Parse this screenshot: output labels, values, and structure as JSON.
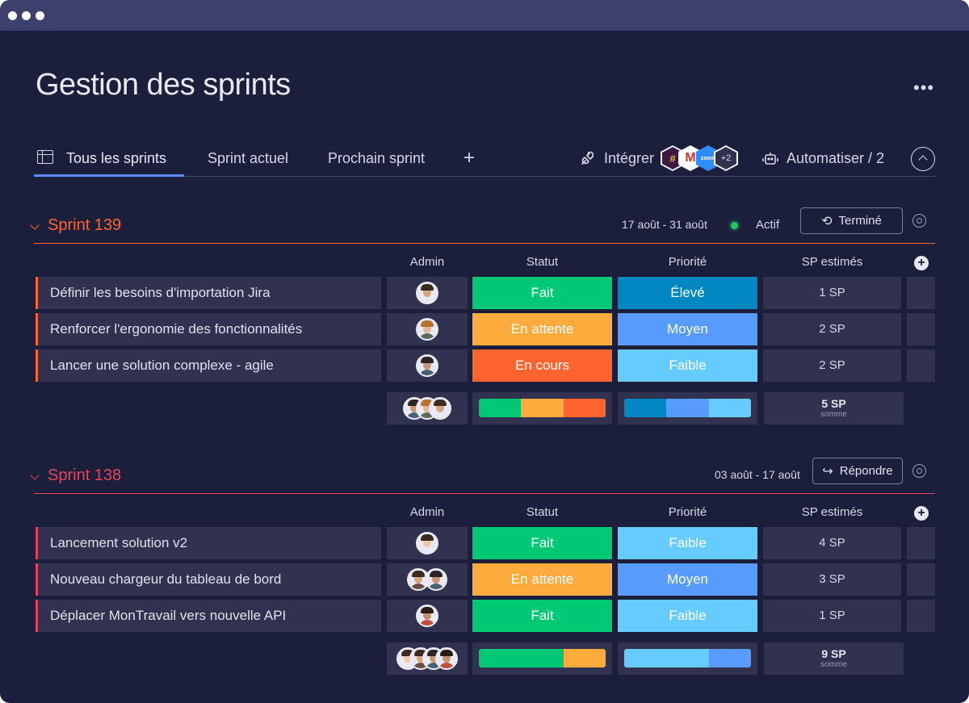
{
  "page": {
    "title": "Gestion des sprints"
  },
  "tabs": [
    {
      "label": "Tous les sprints",
      "active": true
    },
    {
      "label": "Sprint actuel"
    },
    {
      "label": "Prochain sprint"
    }
  ],
  "toolbar": {
    "integrate_label": "Intégrer",
    "integrations_more": "+2",
    "automate_label": "Automatiser / 2"
  },
  "columns": {
    "admin": "Admin",
    "status": "Statut",
    "priority": "Priorité",
    "sp": "SP estimés"
  },
  "colors": {
    "done": "#00c875",
    "waiting": "#fdab3d",
    "in_progress": "#ff642e",
    "high": "#0086c0",
    "medium": "#579bfc",
    "low": "#66ccff"
  },
  "groups": [
    {
      "title": "Sprint 139",
      "color": "#ff642e",
      "dates": "17 août - 31 août",
      "state": "Actif",
      "action": "Terminé",
      "rows": [
        {
          "name": "Définir les besoins d'importation Jira",
          "status": "Fait",
          "priority": "Élevé",
          "sp": "1 SP"
        },
        {
          "name": "Renforcer l'ergonomie des fonctionnalités",
          "status": "En attente",
          "priority": "Moyen",
          "sp": "2 SP"
        },
        {
          "name": "Lancer une solution complexe - agile",
          "status": "En cours",
          "priority": "Faible",
          "sp": "2 SP"
        }
      ],
      "summary": {
        "sp_total": "5 SP",
        "sp_label": "somme",
        "status_share": [
          1,
          1,
          1
        ],
        "priority_share": [
          1,
          1,
          1
        ]
      }
    },
    {
      "title": "Sprint 138",
      "color": "#e2445c",
      "dates": "03 août - 17 août",
      "action": "Répondre",
      "rows": [
        {
          "name": "Lancement solution v2",
          "status": "Fait",
          "priority": "Faible",
          "sp": "4 SP"
        },
        {
          "name": "Nouveau chargeur du tableau de bord",
          "status": "En attente",
          "priority": "Moyen",
          "sp": "3 SP"
        },
        {
          "name": "Déplacer MonTravail vers nouvelle API",
          "status": "Fait",
          "priority": "Faible",
          "sp": "1 SP"
        }
      ],
      "summary": {
        "sp_total": "9 SP",
        "sp_label": "somme",
        "status_share": [
          2,
          1
        ],
        "priority_share": [
          2,
          1
        ]
      }
    }
  ]
}
